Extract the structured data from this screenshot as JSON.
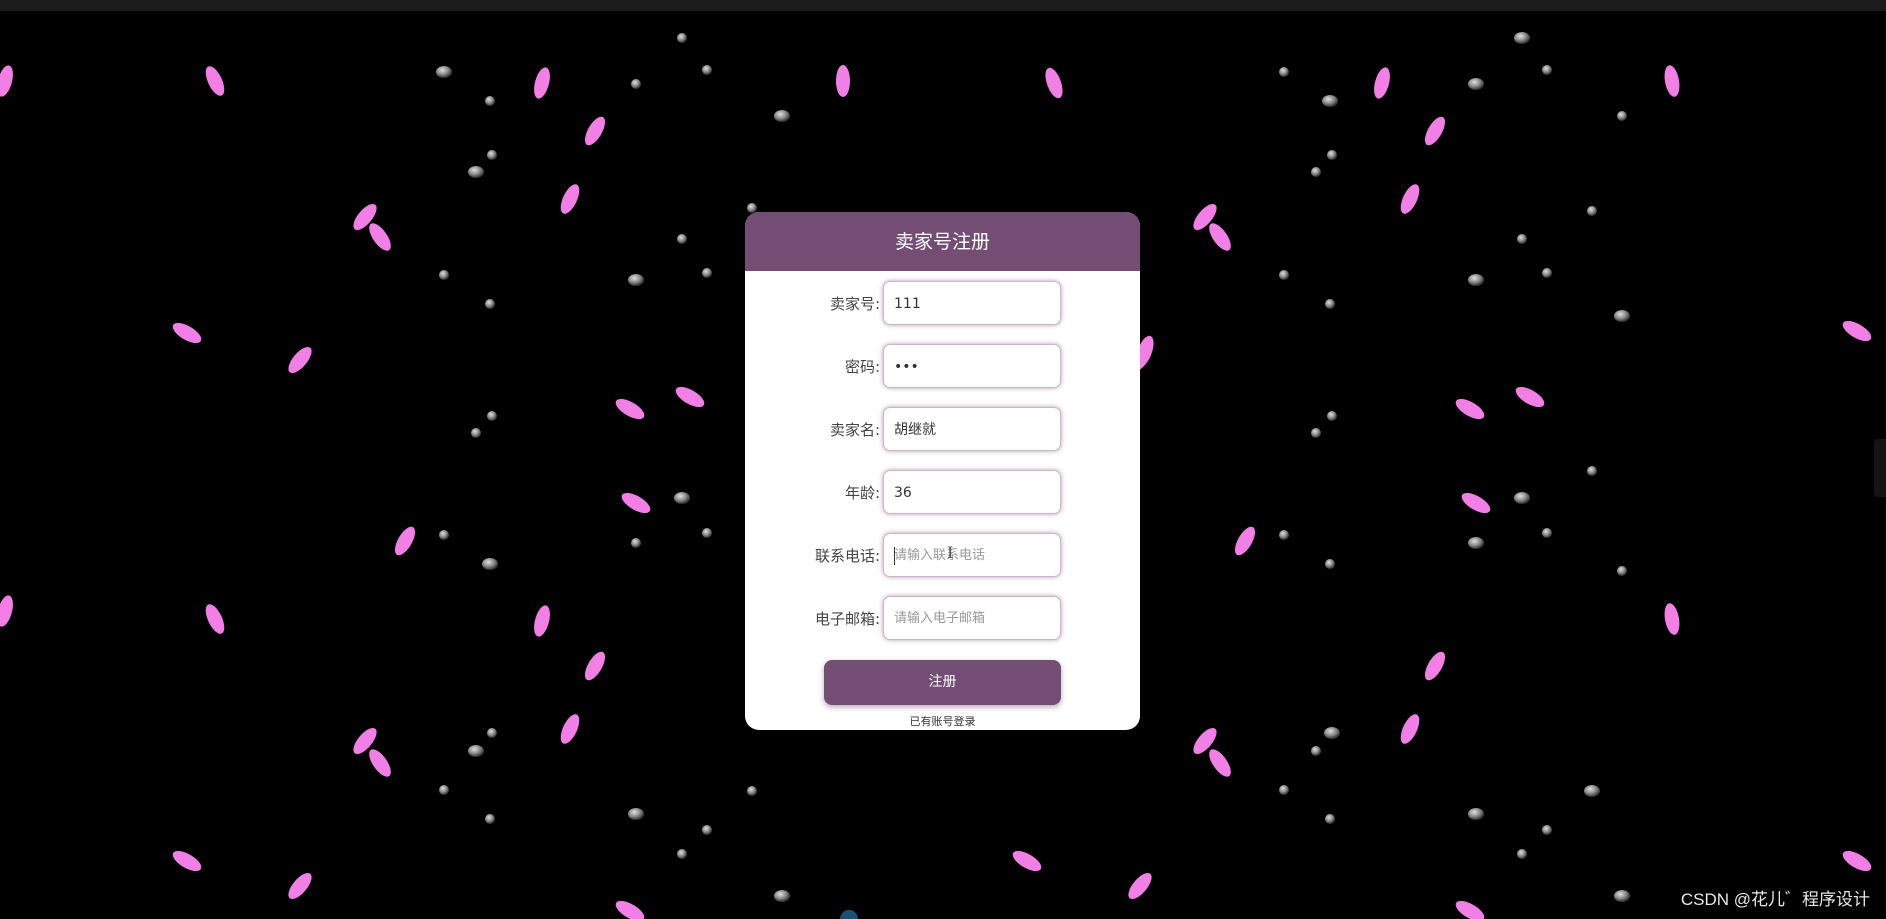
{
  "form": {
    "title": "卖家号注册",
    "fields": [
      {
        "label": "卖家号:",
        "value": "111",
        "placeholder": ""
      },
      {
        "label": "密码:",
        "value": "•••",
        "placeholder": ""
      },
      {
        "label": "卖家名:",
        "value": "胡继就",
        "placeholder": ""
      },
      {
        "label": "年龄:",
        "value": "36",
        "placeholder": ""
      },
      {
        "label": "联系电话:",
        "value": "",
        "placeholder": "请输入联系电话"
      },
      {
        "label": "电子邮箱:",
        "value": "",
        "placeholder": "请输入电子邮箱"
      }
    ],
    "submit_label": "注册",
    "login_link": "已有账号登录"
  },
  "watermark": "CSDN @花儿゛程序设计",
  "colors": {
    "accent": "#734d74",
    "petal": "#f27fe6",
    "background": "#000000"
  }
}
